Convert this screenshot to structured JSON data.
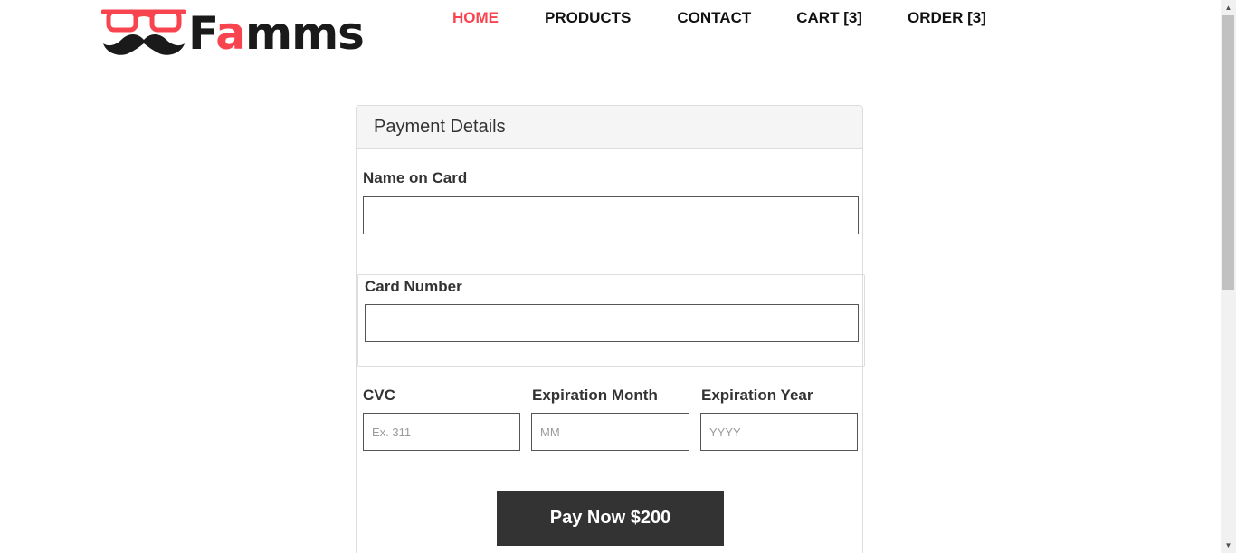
{
  "brand": {
    "name_part1": "F",
    "name_accent": "a",
    "name_part2": "mms",
    "accent_color": "#f7444e",
    "logo_icon": "glasses-mustache-icon"
  },
  "nav": {
    "items": [
      {
        "label": "HOME",
        "active": true
      },
      {
        "label": "PRODUCTS",
        "active": false
      },
      {
        "label": "CONTACT",
        "active": false
      },
      {
        "label": "CART [3]",
        "active": false
      },
      {
        "label": "ORDER [3]",
        "active": false
      }
    ]
  },
  "payment": {
    "heading": "Payment Details",
    "name_label": "Name on Card",
    "name_value": "",
    "card_label": "Card Number",
    "card_value": "",
    "cvc_label": "CVC",
    "cvc_placeholder": "Ex. 311",
    "month_label": "Expiration Month",
    "month_placeholder": "MM",
    "year_label": "Expiration Year",
    "year_placeholder": "YYYY",
    "pay_button_label": "Pay Now $200"
  },
  "colors": {
    "button_bg": "#333333",
    "panel_heading_bg": "#f5f5f5"
  }
}
